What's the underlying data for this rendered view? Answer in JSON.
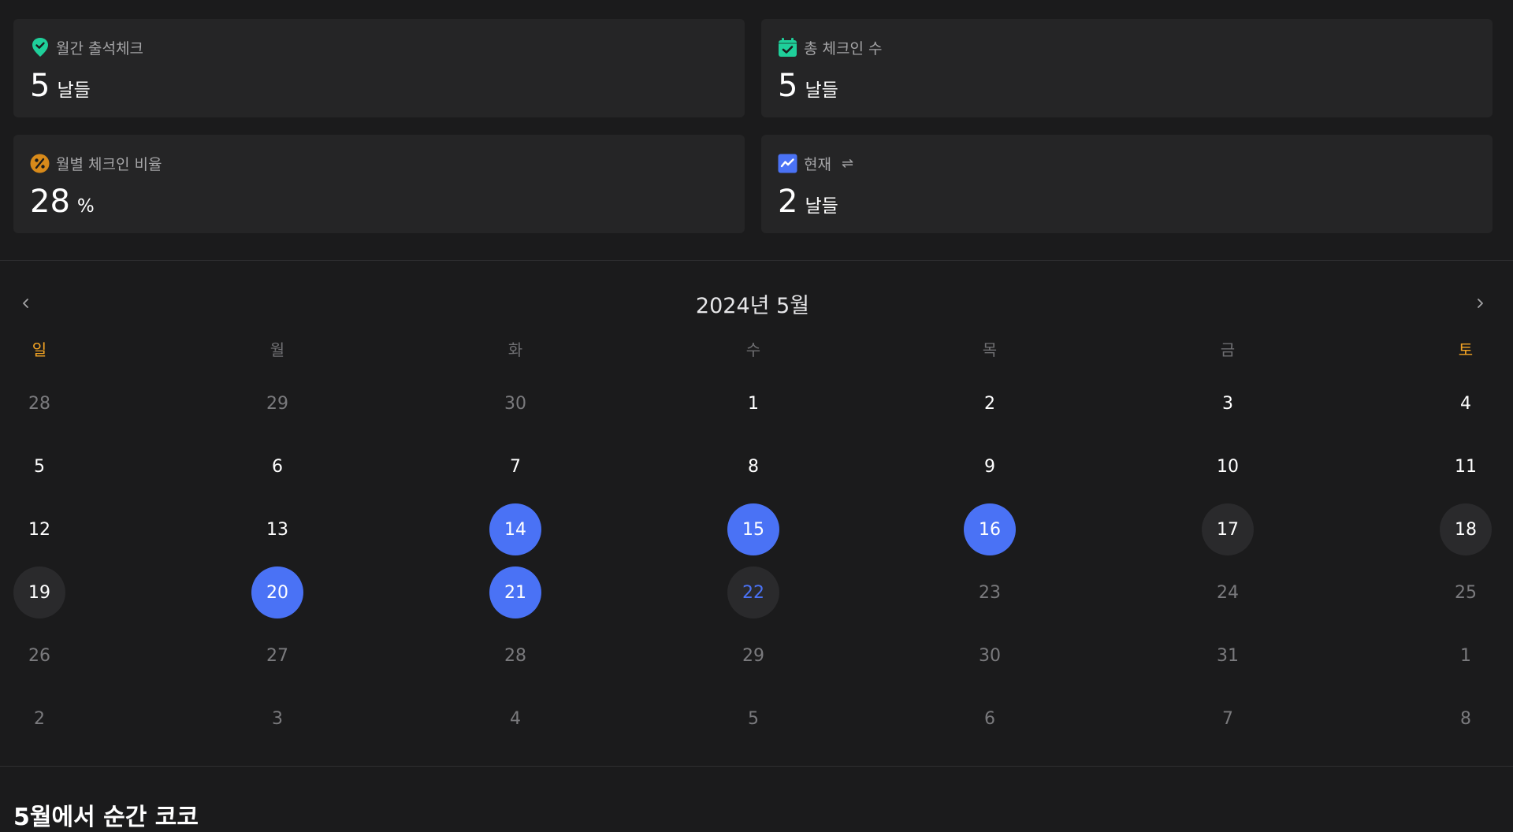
{
  "stats": {
    "monthly": {
      "label": "월간 출석체크",
      "value": "5",
      "unit": "날들",
      "icon": "badge-check-icon",
      "color": "#1fcf9a"
    },
    "total": {
      "label": "총 체크인 수",
      "value": "5",
      "unit": "날들",
      "icon": "calendar-check-icon",
      "color": "#1fcf9a"
    },
    "ratio": {
      "label": "월별 체크인 비율",
      "value": "28",
      "unit": "%",
      "icon": "percent-icon",
      "color": "#d88a1a"
    },
    "current": {
      "label": "현재",
      "swap": "⇌",
      "value": "2",
      "unit": "날들",
      "icon": "trend-chart-icon",
      "color": "#4a72f5"
    }
  },
  "calendar": {
    "title": "2024년 5월",
    "weekdays": [
      "일",
      "월",
      "화",
      "수",
      "목",
      "금",
      "토"
    ],
    "weeks": [
      [
        "28",
        "29",
        "30",
        "1",
        "2",
        "3",
        "4"
      ],
      [
        "5",
        "6",
        "7",
        "8",
        "9",
        "10",
        "11"
      ],
      [
        "12",
        "13",
        "14",
        "15",
        "16",
        "17",
        "18"
      ],
      [
        "19",
        "20",
        "21",
        "22",
        "23",
        "24",
        "25"
      ],
      [
        "26",
        "27",
        "28",
        "29",
        "30",
        "31",
        "1"
      ],
      [
        "2",
        "3",
        "4",
        "5",
        "6",
        "7",
        "8"
      ]
    ],
    "checked_days": [
      "14",
      "15",
      "16",
      "20",
      "21"
    ],
    "today": "22",
    "accent_color": "#4a72f5",
    "weekend_color": "#f5a524"
  },
  "section": {
    "title": "5월에서 순간 코코"
  }
}
